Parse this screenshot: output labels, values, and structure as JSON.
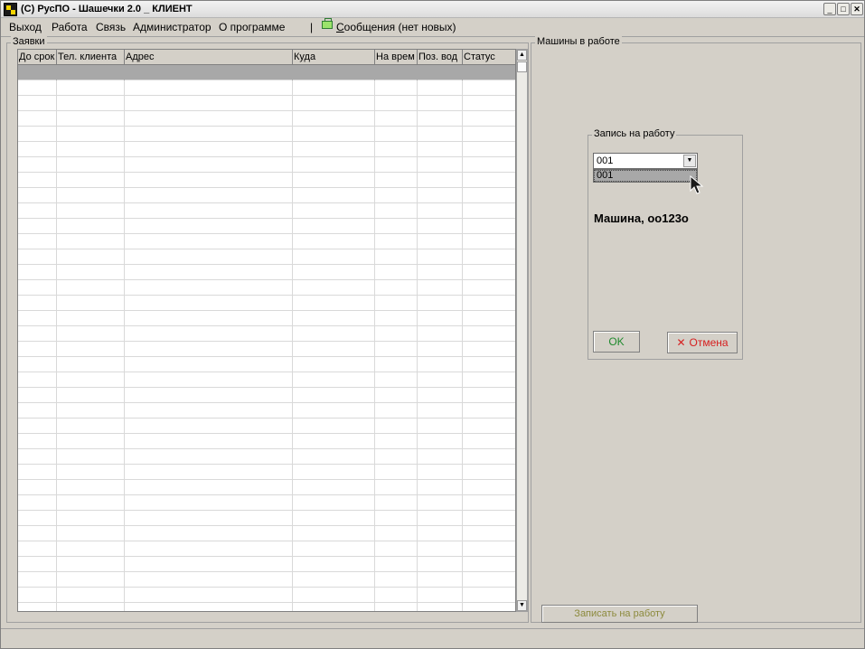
{
  "window": {
    "title": "(С) РусПО - Шашечки 2.0 _ КЛИЕНТ",
    "min_glyph": "_",
    "max_glyph": "□",
    "close_glyph": "✕"
  },
  "menu": {
    "items": [
      "Выход",
      "Работа",
      "Связь",
      "Администратор",
      "О программе"
    ],
    "separator": "|",
    "messages_prefix": "С",
    "messages_rest": "ообщения (нет новых)"
  },
  "orders": {
    "group_label": "Заявки",
    "columns": [
      "До срок",
      "Тел. клиента",
      "Адрес",
      "Куда",
      "На врем",
      "Поз. вод",
      "Статус"
    ]
  },
  "machines": {
    "group_label": "Машины в работе",
    "assign_button": "Записать на работу"
  },
  "dialog": {
    "title": "Запись на работу",
    "combo_value": "001",
    "combo_option": "001",
    "machine_text": "Машина, оо123о",
    "ok_label": "OK",
    "cancel_label": "Отмена"
  },
  "colors": {
    "ok": "#1f8a2d",
    "cancel": "#d62020",
    "assign_text": "#8c8a3c",
    "selected_row": "#a8a8a8"
  }
}
